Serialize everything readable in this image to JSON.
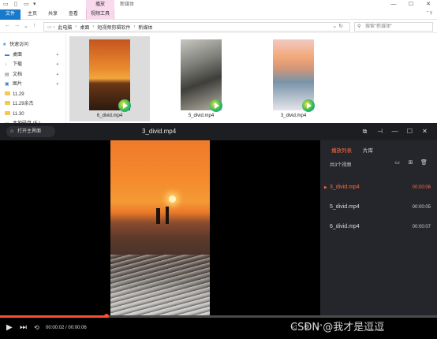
{
  "explorer": {
    "context_tab_header": "播放",
    "window_title": "新媒体",
    "ribbon": {
      "tabs": [
        "文件",
        "主页",
        "共享",
        "查看",
        "视频工具"
      ],
      "right_icon": "help-icon"
    },
    "address": {
      "crumbs": [
        "此电脑",
        "桌面",
        "短视频剪辑软件",
        "新媒体"
      ],
      "search_placeholder": "搜索\"新媒体\""
    },
    "nav": {
      "items": [
        {
          "label": "快速访问",
          "icon": "star-icon",
          "pinned": false
        },
        {
          "label": "桌面",
          "icon": "desktop-icon",
          "pinned": true
        },
        {
          "label": "下载",
          "icon": "download-icon",
          "pinned": true
        },
        {
          "label": "文档",
          "icon": "document-icon",
          "pinned": true
        },
        {
          "label": "图片",
          "icon": "picture-icon",
          "pinned": true
        },
        {
          "label": "11.29",
          "icon": "folder-icon",
          "pinned": false
        },
        {
          "label": "11.29余杰",
          "icon": "folder-icon",
          "pinned": false
        },
        {
          "label": "11.30",
          "icon": "folder-icon",
          "pinned": false
        },
        {
          "label": "本地磁盘 (E:)",
          "icon": "drive-icon",
          "pinned": false
        }
      ]
    },
    "files": [
      {
        "name": "6_divid.mp4",
        "selected": true
      },
      {
        "name": "5_divid.mp4",
        "selected": false
      },
      {
        "name": "3_divid.mp4",
        "selected": false
      }
    ]
  },
  "player": {
    "home_label": "打开主界面",
    "title": "3_divid.mp4",
    "playlist": {
      "tabs": [
        "播放列表",
        "片库"
      ],
      "active_tab": 0,
      "count_label": "共3个视频",
      "items": [
        {
          "name": "3_divid.mp4",
          "duration": "00:00:06",
          "playing": true
        },
        {
          "name": "5_divid.mp4",
          "duration": "00:00:05",
          "playing": false
        },
        {
          "name": "6_divid.mp4",
          "duration": "00:00:07",
          "playing": false
        }
      ]
    },
    "time_text": "00:00:02 / 00:00:06",
    "progress_fraction": 0.333,
    "accent_color": "#ff4b2f"
  },
  "watermark": "CSDN @我才是逗逗"
}
